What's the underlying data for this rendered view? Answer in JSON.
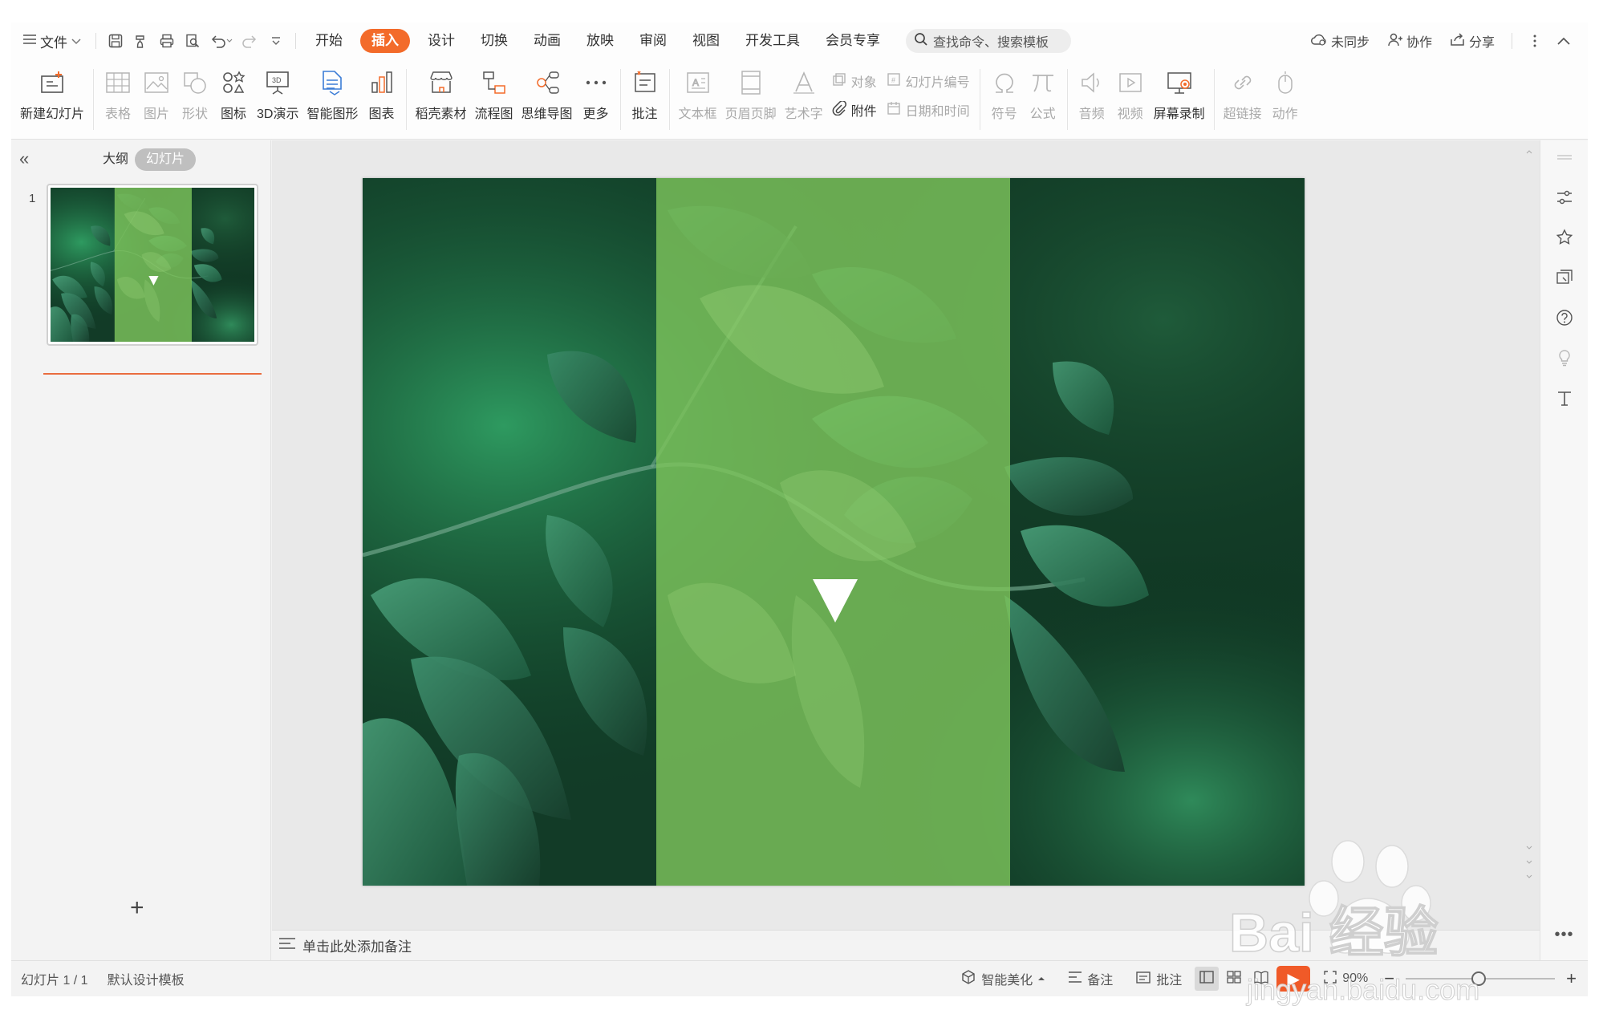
{
  "menu": {
    "file_label": "文件",
    "tabs": [
      "开始",
      "插入",
      "设计",
      "切换",
      "动画",
      "放映",
      "审阅",
      "视图",
      "开发工具",
      "会员专享"
    ],
    "active_tab": "插入",
    "search_placeholder": "查找命令、搜索模板",
    "sync_label": "未同步",
    "collab_label": "协作",
    "share_label": "分享"
  },
  "ribbon": {
    "new_slide": "新建幻灯片",
    "table": "表格",
    "picture": "图片",
    "shape": "形状",
    "icons": "图标",
    "demo3d": "3D演示",
    "smartart": "智能图形",
    "chart": "图表",
    "material": "稻壳素材",
    "flowchart": "流程图",
    "mindmap": "思维导图",
    "more": "更多",
    "comment": "批注",
    "textbox": "文本框",
    "header_footer": "页眉页脚",
    "wordart": "艺术字",
    "object": "对象",
    "slide_number": "幻灯片编号",
    "attachment": "附件",
    "datetime": "日期和时间",
    "symbol": "符号",
    "formula": "公式",
    "audio": "音频",
    "video": "视频",
    "screen_record": "屏幕录制",
    "hyperlink": "超链接",
    "action": "动作"
  },
  "left_pane": {
    "outline_tab": "大纲",
    "slides_tab": "幻灯片",
    "slide_numbers": [
      "1"
    ]
  },
  "notes_placeholder": "单击此处添加备注",
  "status": {
    "slide_count": "幻灯片 1 / 1",
    "template": "默认设计模板",
    "beautify": "智能美化",
    "notes": "备注",
    "comments": "批注",
    "zoom": "90%"
  },
  "watermark": {
    "line1": "Bai 经验",
    "line2": "jingyan.baidu.com"
  },
  "colors": {
    "accent": "#f36b2a",
    "green_band": "#7dc35b",
    "slide_dark": "#0f3a24"
  }
}
